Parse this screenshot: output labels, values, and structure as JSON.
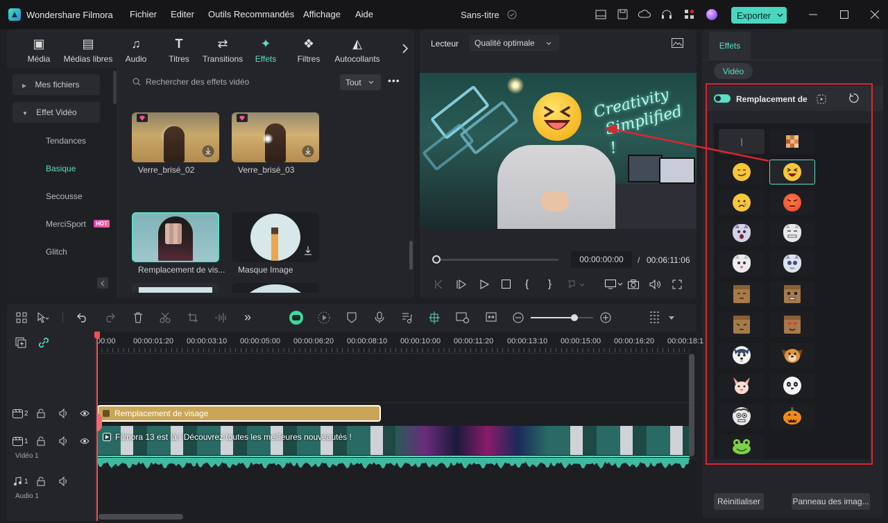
{
  "app": {
    "title": "Wondershare Filmora",
    "project": "Sans-titre",
    "export_label": "Exporter"
  },
  "menu": [
    "Fichier",
    "Editer",
    "Outils Recommandés",
    "Affichage",
    "Aide"
  ],
  "media_tabs": [
    {
      "label": "Média",
      "icon": "media-icon"
    },
    {
      "label": "Médias libres",
      "icon": "stock-media-icon"
    },
    {
      "label": "Audio",
      "icon": "music-note-icon"
    },
    {
      "label": "Titres",
      "icon": "text-icon"
    },
    {
      "label": "Transitions",
      "icon": "transitions-icon"
    },
    {
      "label": "Effets",
      "icon": "effects-star-icon"
    },
    {
      "label": "Filtres",
      "icon": "filters-icon"
    },
    {
      "label": "Autocollants",
      "icon": "stickers-icon"
    }
  ],
  "sidebar": {
    "items": [
      "Mes fichiers",
      "Effet Vidéo"
    ],
    "subitems": [
      "Tendances",
      "Basique",
      "Secousse",
      "MerciSport",
      "Glitch"
    ],
    "hot_badge": "HOT"
  },
  "search": {
    "placeholder": "Rechercher des effets vidéo",
    "filter": "Tout"
  },
  "effects": {
    "labels": [
      "Verre_brisé_02",
      "Verre_brisé_03",
      "Remplacement de vis...",
      "Masque Image"
    ]
  },
  "player": {
    "label": "Lecteur",
    "quality": "Qualité optimale",
    "current_time": "00:00:00:00",
    "separator": "/",
    "total_time": "00:06:11:06",
    "progress": 0
  },
  "properties": {
    "tab": "Effets",
    "subtab": "Vidéo",
    "effect_name": "Remplacement de v",
    "reset_label": "Réinitialiser",
    "panel_label": "Panneau des imag..."
  },
  "timeline": {
    "ruler": [
      "00:00",
      "00:00:01:20",
      "00:00:03:10",
      "00:00:05:00",
      "00:00:06:20",
      "00:00:08:10",
      "00:00:10:00",
      "00:00:11:20",
      "00:00:13:10",
      "00:00:15:00",
      "00:00:16:20",
      "00:00:18:1"
    ],
    "tracks": [
      {
        "num": "2"
      },
      {
        "num": "1",
        "name": "Vidéo 1"
      },
      {
        "num": "1",
        "name": "Audio 1"
      }
    ],
    "effect_clip": "Remplacement de visage",
    "video_clip": "Filmora 13 est là ! Découvrez toutes les meilleures nouveautés !",
    "zoom_level": 0.7
  },
  "colors": {
    "accent": "#59e0c5",
    "highlight": "#e0242f",
    "effect_clip": "#c9a557",
    "playhead": "#f04f58"
  }
}
